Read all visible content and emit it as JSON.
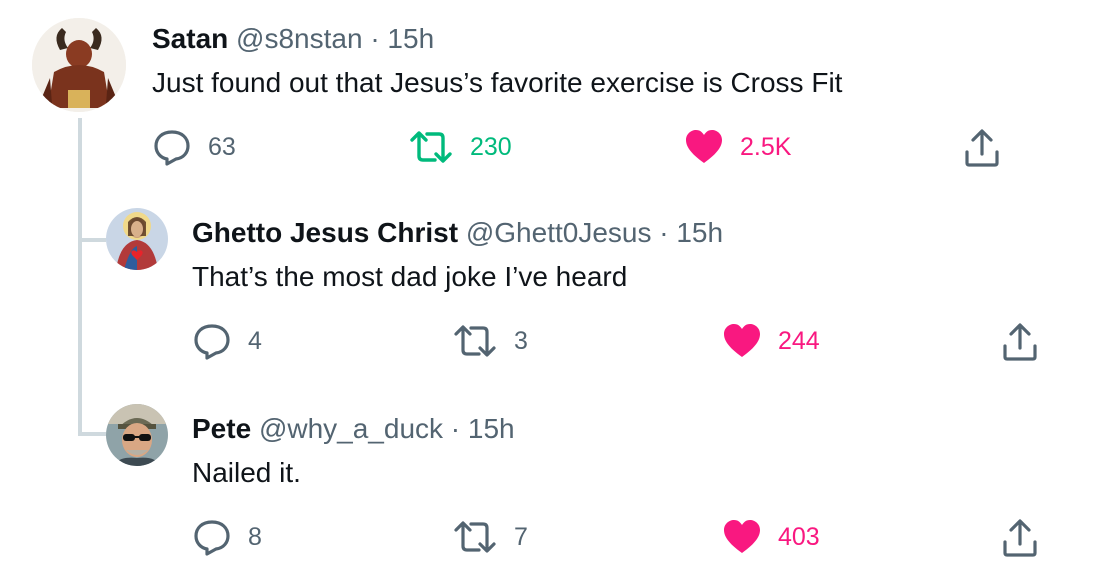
{
  "tweets": [
    {
      "name": "Satan",
      "handle": "@s8nstan",
      "separator": "·",
      "time": "15h",
      "text": "Just found out that Jesus’s favorite exercise is Cross Fit",
      "replies": "63",
      "retweets": "230",
      "likes": "2.5K",
      "retweeted": true,
      "liked": true
    },
    {
      "name": "Ghetto Jesus Christ",
      "handle": "@Ghett0Jesus",
      "separator": "·",
      "time": "15h",
      "text": "That’s the most dad joke I’ve heard",
      "replies": "4",
      "retweets": "3",
      "likes": "244",
      "retweeted": false,
      "liked": true
    },
    {
      "name": "Pete",
      "handle": "@why_a_duck",
      "separator": "·",
      "time": "15h",
      "text": "Nailed it.",
      "replies": "8",
      "retweets": "7",
      "likes": "403",
      "retweeted": false,
      "liked": true
    }
  ],
  "icons": {
    "reply": "reply-icon",
    "retweet": "retweet-icon",
    "like": "heart-icon",
    "share": "share-icon"
  },
  "colors": {
    "retweet_active": "#00ba7c",
    "like_active": "#f91880",
    "muted": "#536471",
    "thread_line": "#cfd9de"
  }
}
